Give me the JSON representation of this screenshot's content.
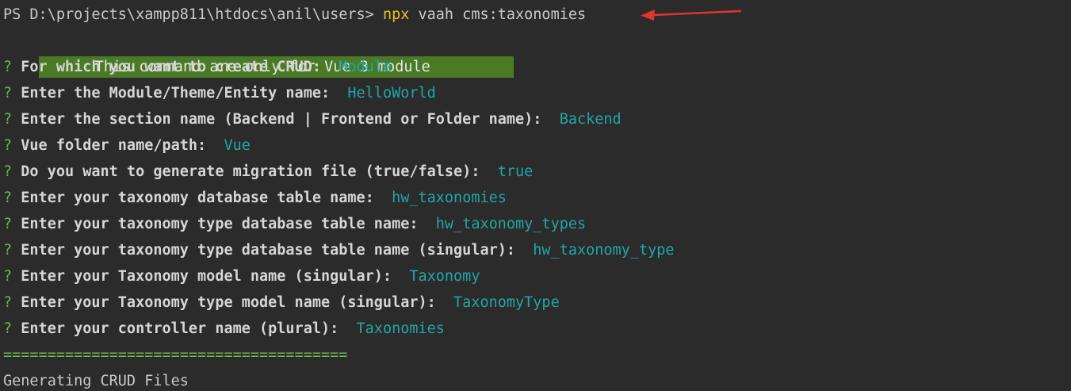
{
  "colors": {
    "background": "#2b2b2b",
    "npx": "#e6c229",
    "banner_bg": "#4a7a26",
    "qmark": "#6fb34a",
    "answer": "#22a6a6",
    "separator": "#6fb34a",
    "arrow": "#e0342f"
  },
  "prompt": {
    "host": "PS D:\\projects\\xampp811\\htdocs\\anil\\users> ",
    "npx": "npx",
    "rest": " vaah cms:taxonomies"
  },
  "banner": "This command are only for Vue 3 module",
  "questions": [
    {
      "mark": "?",
      "q": "For which you want to create CRUD:",
      "a": "Module"
    },
    {
      "mark": "?",
      "q": "Enter the Module/Theme/Entity name:",
      "a": "HelloWorld"
    },
    {
      "mark": "?",
      "q": "Enter the section name (Backend | Frontend or Folder name):",
      "a": "Backend"
    },
    {
      "mark": "?",
      "q": "Vue folder name/path:",
      "a": "Vue"
    },
    {
      "mark": "?",
      "q": "Do you want to generate migration file (true/false):",
      "a": "true"
    },
    {
      "mark": "?",
      "q": "Enter your taxonomy database table name:",
      "a": "hw_taxonomies"
    },
    {
      "mark": "?",
      "q": "Enter your taxonomy type database table name:",
      "a": "hw_taxonomy_types"
    },
    {
      "mark": "?",
      "q": "Enter your taxonomy type database table name (singular):",
      "a": "hw_taxonomy_type"
    },
    {
      "mark": "?",
      "q": "Enter your Taxonomy model name (singular):",
      "a": "Taxonomy"
    },
    {
      "mark": "?",
      "q": "Enter your Taxonomy type model name (singular):",
      "a": "TaxonomyType"
    },
    {
      "mark": "?",
      "q": "Enter your controller name (plural):",
      "a": "Taxonomies"
    }
  ],
  "separator": "=======================================",
  "status": "Generating CRUD Files",
  "icons": {
    "arrow": "red-arrow-icon"
  }
}
